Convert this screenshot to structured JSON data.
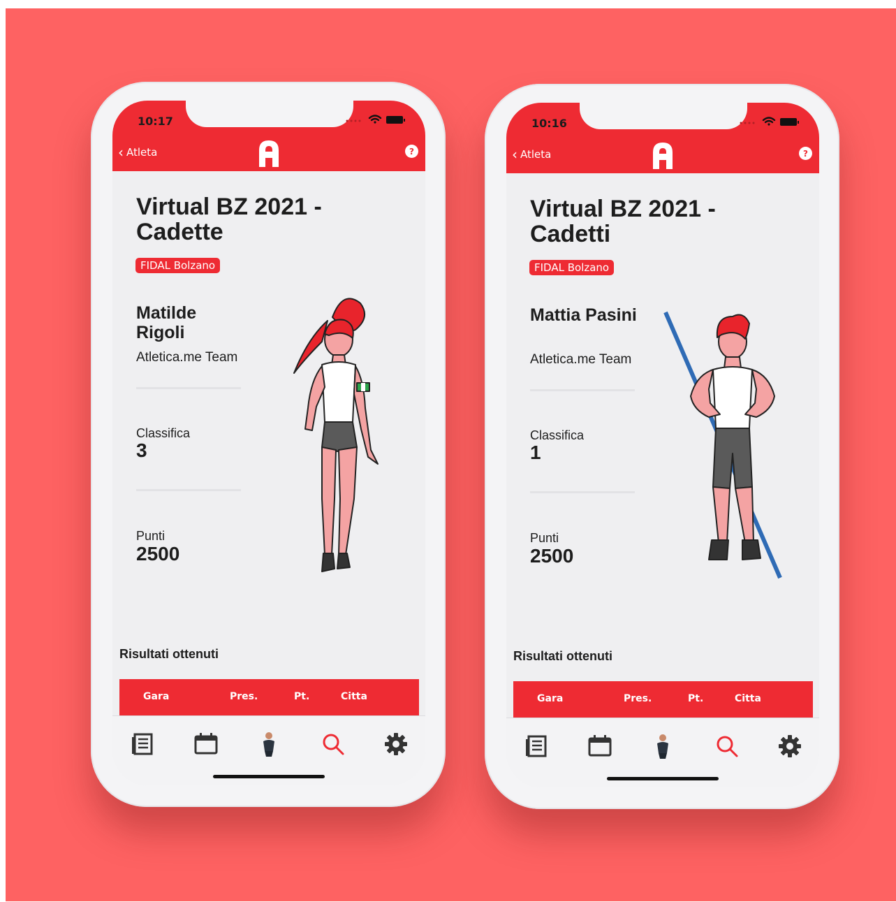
{
  "phones": [
    {
      "status": {
        "time": "10:17"
      },
      "header": {
        "back_label": "Atleta",
        "help_label": "?"
      },
      "event": {
        "title": "Virtual BZ 2021 - Cadette",
        "badge": "FIDAL Bolzano"
      },
      "athlete": {
        "name": "Matilde Rigoli",
        "team": "Atletica.me Team",
        "classifica_label": "Classifica",
        "classifica_value": "3",
        "punti_label": "Punti",
        "punti_value": "2500",
        "figure_icon": "female-athlete-illustration"
      },
      "results": {
        "title": "Risultati ottenuti",
        "columns": [
          "Gara",
          "Pres.",
          "Pt.",
          "Citta"
        ]
      }
    },
    {
      "status": {
        "time": "10:16"
      },
      "header": {
        "back_label": "Atleta",
        "help_label": "?"
      },
      "event": {
        "title": "Virtual BZ 2021 - Cadetti",
        "badge": "FIDAL Bolzano"
      },
      "athlete": {
        "name": "Mattia Pasini",
        "team": "Atletica.me Team",
        "classifica_label": "Classifica",
        "classifica_value": "1",
        "punti_label": "Punti",
        "punti_value": "2500",
        "figure_icon": "male-javelin-athlete-illustration"
      },
      "results": {
        "title": "Risultati ottenuti",
        "columns": [
          "Gara",
          "Pres.",
          "Pt.",
          "Citta"
        ]
      }
    }
  ],
  "tabbar": {
    "icons": [
      "news-icon",
      "calendar-icon",
      "athlete-avatar-icon",
      "search-icon",
      "settings-gear-icon"
    ],
    "active": "search-icon"
  },
  "colors": {
    "background": "#fe6262",
    "brand_red": "#ee2b33",
    "screen_bg": "#efeff1",
    "text": "#1d1d1d"
  }
}
